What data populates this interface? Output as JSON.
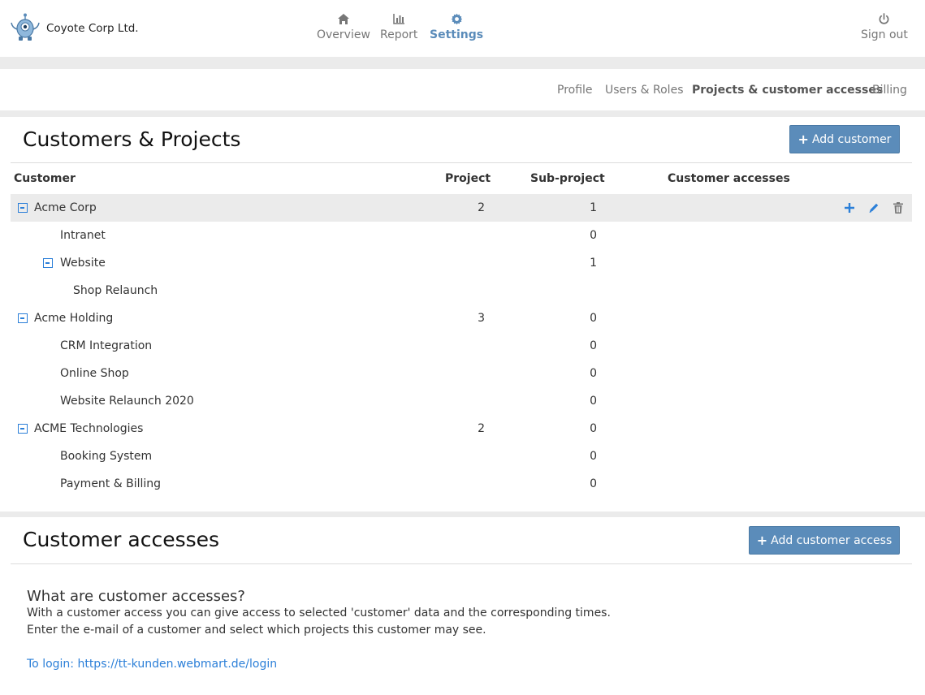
{
  "brand": {
    "name": "Coyote Corp Ltd.",
    "logo_icon": "robot-logo-icon"
  },
  "nav": {
    "overview": "Overview",
    "report": "Report",
    "settings": "Settings",
    "signout": "Sign out"
  },
  "subnav": {
    "profile": "Profile",
    "users": "Users & Roles",
    "projects": "Projects & customer accesses",
    "billing": "Billing"
  },
  "customers_panel": {
    "title": "Customers & Projects",
    "add_label": "Add customer",
    "headers": {
      "customer": "Customer",
      "project": "Project",
      "subproject": "Sub-project",
      "accesses": "Customer accesses"
    },
    "rows": [
      {
        "name": "Acme Corp",
        "project": "2",
        "subproject": "1"
      },
      {
        "name": "Intranet",
        "project": "",
        "subproject": "0"
      },
      {
        "name": "Website",
        "project": "",
        "subproject": "1"
      },
      {
        "name": "Shop Relaunch",
        "project": "",
        "subproject": ""
      },
      {
        "name": "Acme Holding",
        "project": "3",
        "subproject": "0"
      },
      {
        "name": "CRM Integration",
        "project": "",
        "subproject": "0"
      },
      {
        "name": "Online Shop",
        "project": "",
        "subproject": "0"
      },
      {
        "name": "Website Relaunch 2020",
        "project": "",
        "subproject": "0"
      },
      {
        "name": "ACME Technologies",
        "project": "2",
        "subproject": "0"
      },
      {
        "name": "Booking System",
        "project": "",
        "subproject": "0"
      },
      {
        "name": "Payment & Billing",
        "project": "",
        "subproject": "0"
      }
    ]
  },
  "accesses_panel": {
    "title": "Customer accesses",
    "add_label": "Add customer access",
    "info_title": "What are customer accesses?",
    "info_line1": "With a customer access you can give access to selected 'customer' data and the corresponding times.",
    "info_line2": "Enter the e-mail of a customer and select which projects this customer may see.",
    "login_link": "To login: https://tt-kunden.webmart.de/login"
  },
  "colors": {
    "accent": "#5b8cba",
    "link": "#2b7fd8"
  }
}
